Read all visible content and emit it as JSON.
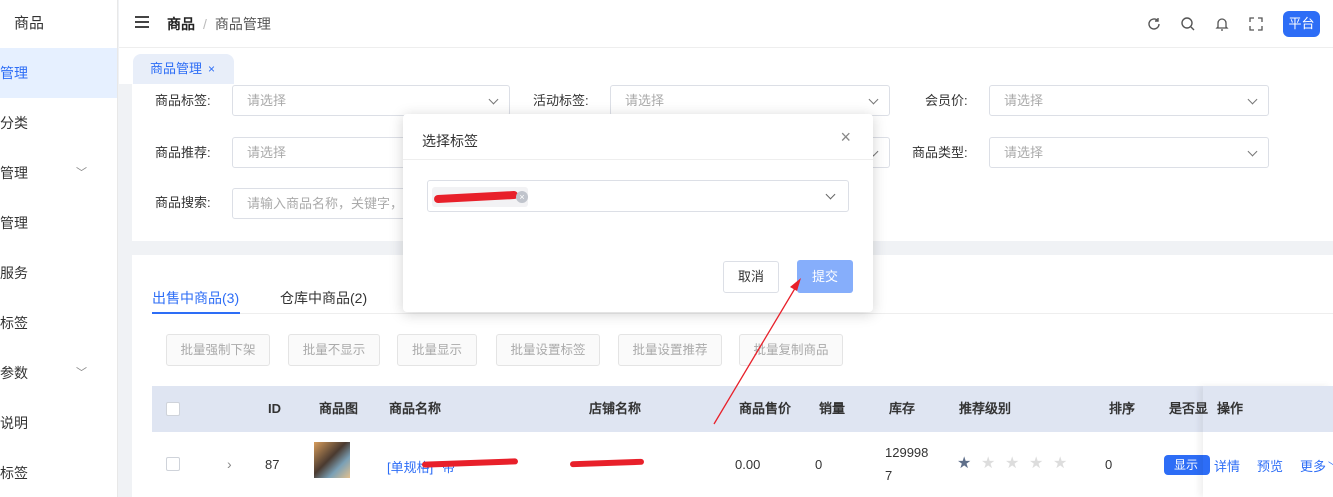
{
  "sidebar": {
    "brand": "商品",
    "items": [
      {
        "label": "管理",
        "active": true,
        "has_children": false
      },
      {
        "label": "分类",
        "active": false,
        "has_children": false
      },
      {
        "label": "管理",
        "active": false,
        "has_children": true
      },
      {
        "label": "管理",
        "active": false,
        "has_children": false
      },
      {
        "label": "服务",
        "active": false,
        "has_children": false
      },
      {
        "label": "标签",
        "active": false,
        "has_children": false
      },
      {
        "label": "参数",
        "active": false,
        "has_children": true
      },
      {
        "label": "说明",
        "active": false,
        "has_children": false
      },
      {
        "label": "标签",
        "active": false,
        "has_children": false
      }
    ]
  },
  "header": {
    "breadcrumb_root": "商品",
    "breadcrumb_sep": "/",
    "breadcrumb_current": "商品管理",
    "platform_label": "平台"
  },
  "tabs": {
    "active_tab": "商品管理",
    "close_glyph": "×"
  },
  "filters": {
    "goods_tag_label": "商品标签:",
    "goods_tag_placeholder": "请选择",
    "activity_tag_label": "活动标签:",
    "activity_tag_placeholder": "请选择",
    "member_price_label": "会员价:",
    "member_price_placeholder": "请选择",
    "recommend_label": "商品推荐:",
    "recommend_placeholder": "请选择",
    "goods_type_label": "商品类型:",
    "goods_type_placeholder": "请选择",
    "search_label": "商品搜索:",
    "search_placeholder": "请输入商品名称，关键字，产"
  },
  "goods_tabs": [
    {
      "label": "出售中商品(3)",
      "active": true
    },
    {
      "label": "仓库中商品(2)",
      "active": false
    }
  ],
  "batch_buttons": [
    "批量强制下架",
    "批量不显示",
    "批量显示",
    "批量设置标签",
    "批量设置推荐",
    "批量复制商品"
  ],
  "table": {
    "columns": [
      "ID",
      "商品图",
      "商品名称",
      "店铺名称",
      "商品售价",
      "销量",
      "库存",
      "推荐级别",
      "排序",
      "是否显",
      "操作"
    ],
    "rows": [
      {
        "id": "87",
        "name_prefix": "[单规格]",
        "name_visible": "带",
        "price": "0.00",
        "sales": "0",
        "stock_line1": "129998",
        "stock_line2": "7",
        "stars_on": 1,
        "stars_total": 5,
        "sort": "0",
        "display_label": "显示",
        "ops": [
          "详情",
          "预览",
          "更多"
        ]
      }
    ]
  },
  "modal": {
    "title": "选择标签",
    "close_glyph": "×",
    "chip_remove_glyph": "×",
    "cancel_label": "取消",
    "submit_label": "提交"
  },
  "colors": {
    "primary": "#2d6df6",
    "submit_disabled": "#86aefb",
    "annotation_red": "#e8202a",
    "table_header_bg": "#dfe5f2"
  }
}
